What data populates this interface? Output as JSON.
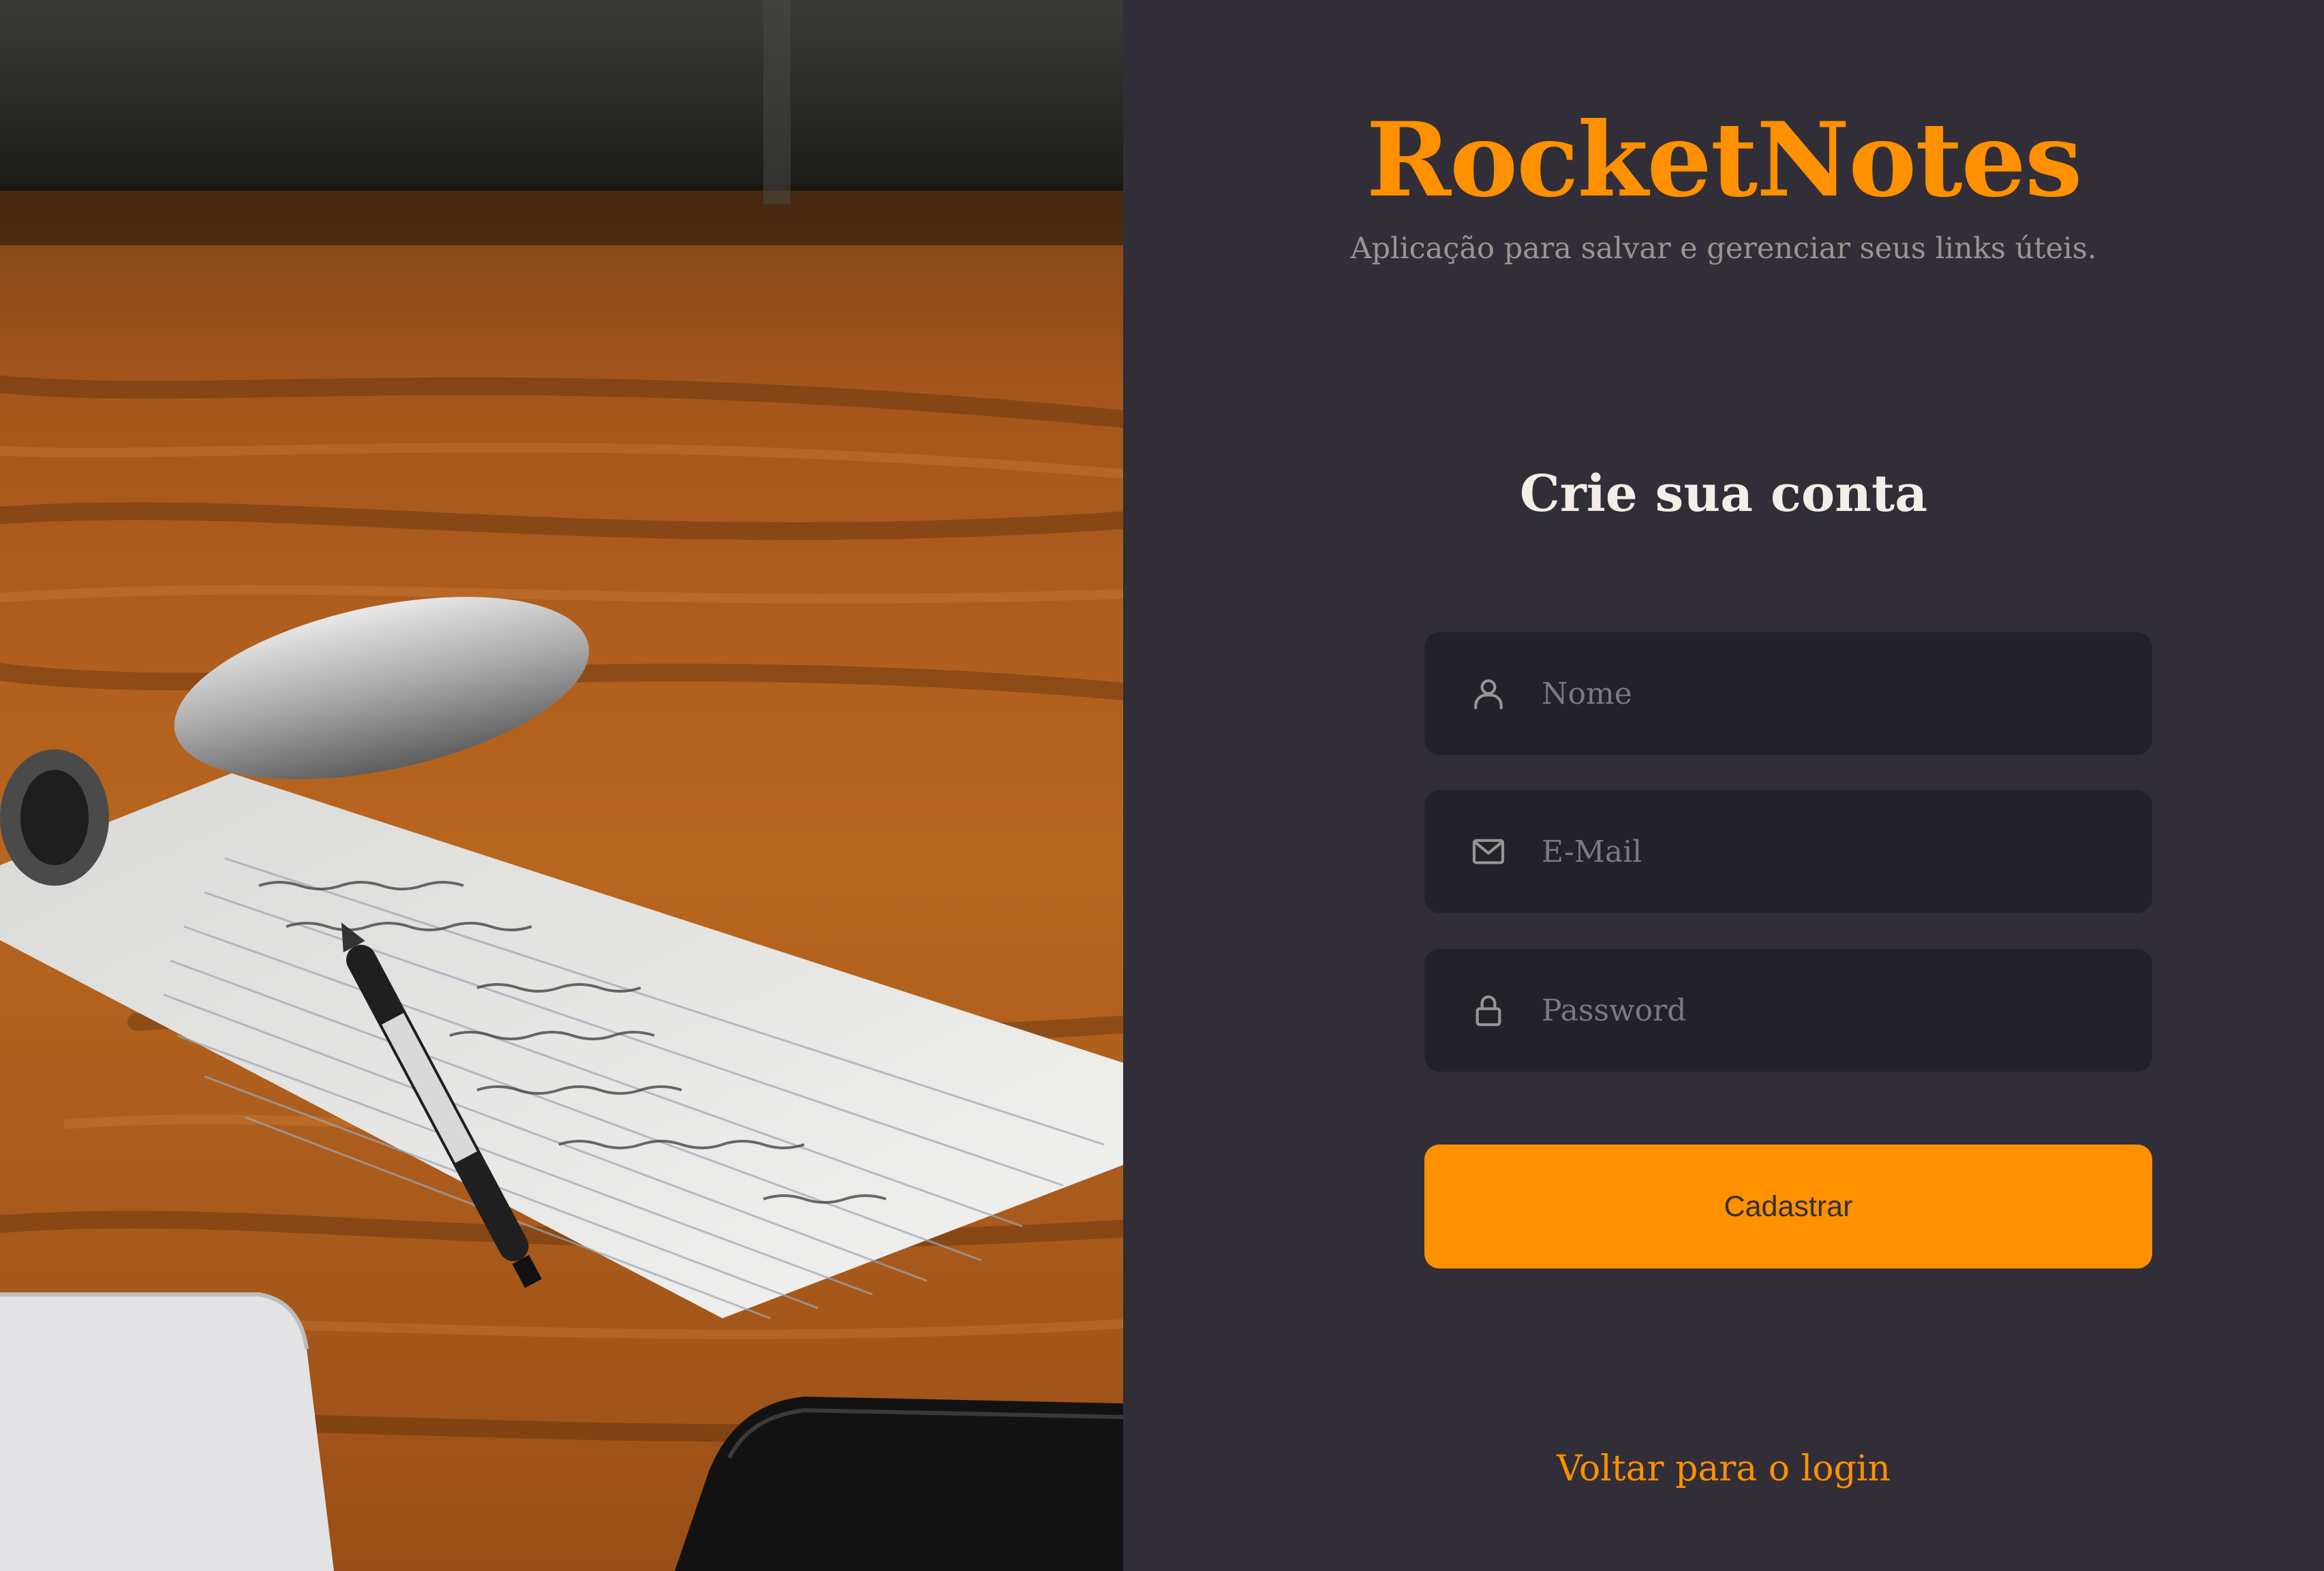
{
  "brand": {
    "title": "RocketNotes",
    "subtitle": "Aplicação para salvar e gerenciar seus links úteis."
  },
  "form": {
    "heading": "Crie sua conta",
    "fields": {
      "name": {
        "placeholder": "Nome",
        "value": "",
        "icon": "user-icon"
      },
      "email": {
        "placeholder": "E-Mail",
        "value": "",
        "icon": "mail-icon"
      },
      "password": {
        "placeholder": "Password",
        "value": "",
        "icon": "lock-icon"
      }
    },
    "submit_label": "Cadastrar",
    "back_link_label": "Voltar para o login"
  },
  "colors": {
    "accent": "#FF9000",
    "background": "#312E38",
    "input_background": "#232129",
    "heading_text": "#F4EDE8",
    "muted_text": "#999591",
    "placeholder_text": "#7C7A80"
  },
  "photo": {
    "subject": "notepad-with-pen-on-wooden-desk"
  }
}
